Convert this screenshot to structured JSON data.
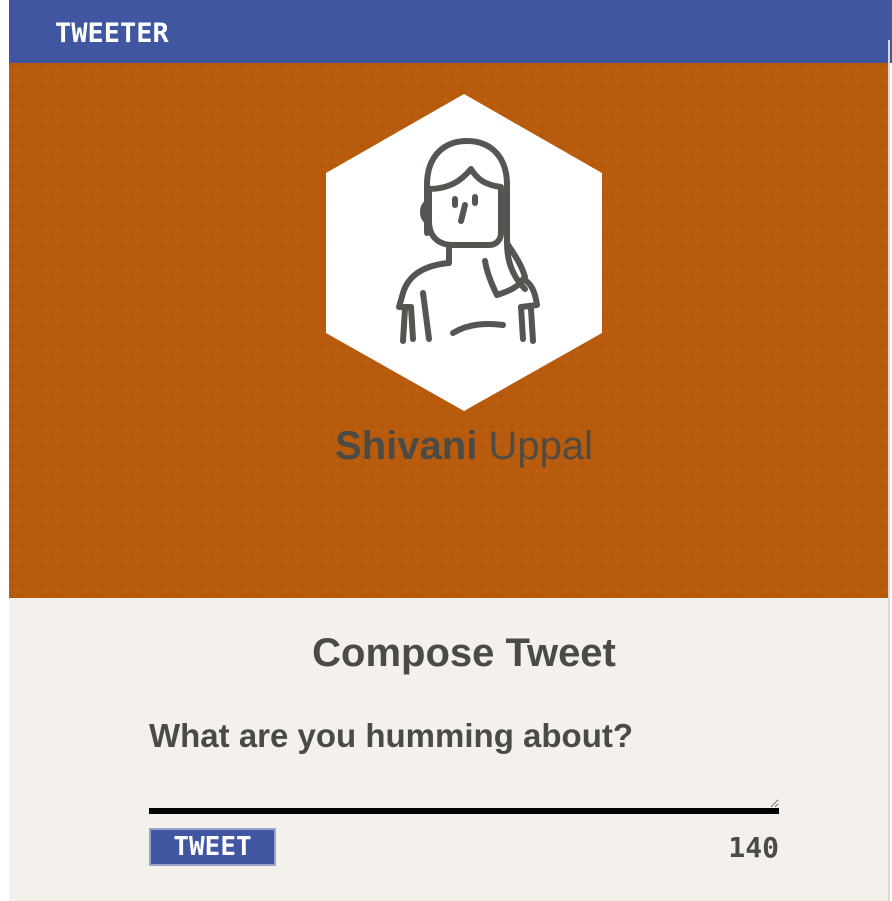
{
  "nav": {
    "title": "TWEETER"
  },
  "profile": {
    "avatar_icon": "woman-avatar-icon",
    "first_name": "Shivani",
    "last_name": "Uppal"
  },
  "compose": {
    "title": "Compose Tweet",
    "prompt": "What are you humming about?",
    "text_value": "",
    "button_label": "TWEET",
    "counter": "140"
  },
  "colors": {
    "nav_bg": "#4056a1",
    "header_bg": "#b85b0d",
    "compose_bg": "#f4f1ec",
    "text": "#4b4a45"
  }
}
